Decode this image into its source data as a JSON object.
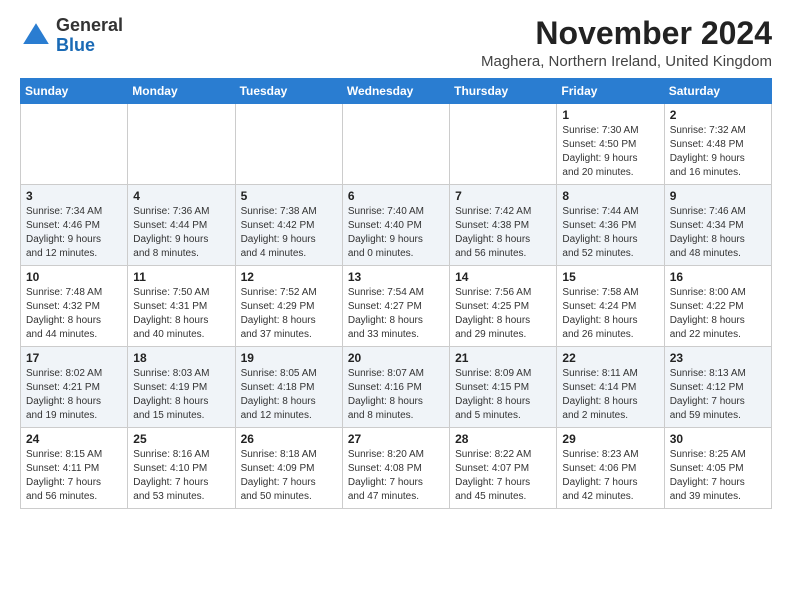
{
  "header": {
    "logo_general": "General",
    "logo_blue": "Blue",
    "month_title": "November 2024",
    "location": "Maghera, Northern Ireland, United Kingdom"
  },
  "days_of_week": [
    "Sunday",
    "Monday",
    "Tuesday",
    "Wednesday",
    "Thursday",
    "Friday",
    "Saturday"
  ],
  "weeks": [
    [
      {
        "day": "",
        "info": ""
      },
      {
        "day": "",
        "info": ""
      },
      {
        "day": "",
        "info": ""
      },
      {
        "day": "",
        "info": ""
      },
      {
        "day": "",
        "info": ""
      },
      {
        "day": "1",
        "info": "Sunrise: 7:30 AM\nSunset: 4:50 PM\nDaylight: 9 hours\nand 20 minutes."
      },
      {
        "day": "2",
        "info": "Sunrise: 7:32 AM\nSunset: 4:48 PM\nDaylight: 9 hours\nand 16 minutes."
      }
    ],
    [
      {
        "day": "3",
        "info": "Sunrise: 7:34 AM\nSunset: 4:46 PM\nDaylight: 9 hours\nand 12 minutes."
      },
      {
        "day": "4",
        "info": "Sunrise: 7:36 AM\nSunset: 4:44 PM\nDaylight: 9 hours\nand 8 minutes."
      },
      {
        "day": "5",
        "info": "Sunrise: 7:38 AM\nSunset: 4:42 PM\nDaylight: 9 hours\nand 4 minutes."
      },
      {
        "day": "6",
        "info": "Sunrise: 7:40 AM\nSunset: 4:40 PM\nDaylight: 9 hours\nand 0 minutes."
      },
      {
        "day": "7",
        "info": "Sunrise: 7:42 AM\nSunset: 4:38 PM\nDaylight: 8 hours\nand 56 minutes."
      },
      {
        "day": "8",
        "info": "Sunrise: 7:44 AM\nSunset: 4:36 PM\nDaylight: 8 hours\nand 52 minutes."
      },
      {
        "day": "9",
        "info": "Sunrise: 7:46 AM\nSunset: 4:34 PM\nDaylight: 8 hours\nand 48 minutes."
      }
    ],
    [
      {
        "day": "10",
        "info": "Sunrise: 7:48 AM\nSunset: 4:32 PM\nDaylight: 8 hours\nand 44 minutes."
      },
      {
        "day": "11",
        "info": "Sunrise: 7:50 AM\nSunset: 4:31 PM\nDaylight: 8 hours\nand 40 minutes."
      },
      {
        "day": "12",
        "info": "Sunrise: 7:52 AM\nSunset: 4:29 PM\nDaylight: 8 hours\nand 37 minutes."
      },
      {
        "day": "13",
        "info": "Sunrise: 7:54 AM\nSunset: 4:27 PM\nDaylight: 8 hours\nand 33 minutes."
      },
      {
        "day": "14",
        "info": "Sunrise: 7:56 AM\nSunset: 4:25 PM\nDaylight: 8 hours\nand 29 minutes."
      },
      {
        "day": "15",
        "info": "Sunrise: 7:58 AM\nSunset: 4:24 PM\nDaylight: 8 hours\nand 26 minutes."
      },
      {
        "day": "16",
        "info": "Sunrise: 8:00 AM\nSunset: 4:22 PM\nDaylight: 8 hours\nand 22 minutes."
      }
    ],
    [
      {
        "day": "17",
        "info": "Sunrise: 8:02 AM\nSunset: 4:21 PM\nDaylight: 8 hours\nand 19 minutes."
      },
      {
        "day": "18",
        "info": "Sunrise: 8:03 AM\nSunset: 4:19 PM\nDaylight: 8 hours\nand 15 minutes."
      },
      {
        "day": "19",
        "info": "Sunrise: 8:05 AM\nSunset: 4:18 PM\nDaylight: 8 hours\nand 12 minutes."
      },
      {
        "day": "20",
        "info": "Sunrise: 8:07 AM\nSunset: 4:16 PM\nDaylight: 8 hours\nand 8 minutes."
      },
      {
        "day": "21",
        "info": "Sunrise: 8:09 AM\nSunset: 4:15 PM\nDaylight: 8 hours\nand 5 minutes."
      },
      {
        "day": "22",
        "info": "Sunrise: 8:11 AM\nSunset: 4:14 PM\nDaylight: 8 hours\nand 2 minutes."
      },
      {
        "day": "23",
        "info": "Sunrise: 8:13 AM\nSunset: 4:12 PM\nDaylight: 7 hours\nand 59 minutes."
      }
    ],
    [
      {
        "day": "24",
        "info": "Sunrise: 8:15 AM\nSunset: 4:11 PM\nDaylight: 7 hours\nand 56 minutes."
      },
      {
        "day": "25",
        "info": "Sunrise: 8:16 AM\nSunset: 4:10 PM\nDaylight: 7 hours\nand 53 minutes."
      },
      {
        "day": "26",
        "info": "Sunrise: 8:18 AM\nSunset: 4:09 PM\nDaylight: 7 hours\nand 50 minutes."
      },
      {
        "day": "27",
        "info": "Sunrise: 8:20 AM\nSunset: 4:08 PM\nDaylight: 7 hours\nand 47 minutes."
      },
      {
        "day": "28",
        "info": "Sunrise: 8:22 AM\nSunset: 4:07 PM\nDaylight: 7 hours\nand 45 minutes."
      },
      {
        "day": "29",
        "info": "Sunrise: 8:23 AM\nSunset: 4:06 PM\nDaylight: 7 hours\nand 42 minutes."
      },
      {
        "day": "30",
        "info": "Sunrise: 8:25 AM\nSunset: 4:05 PM\nDaylight: 7 hours\nand 39 minutes."
      }
    ]
  ]
}
